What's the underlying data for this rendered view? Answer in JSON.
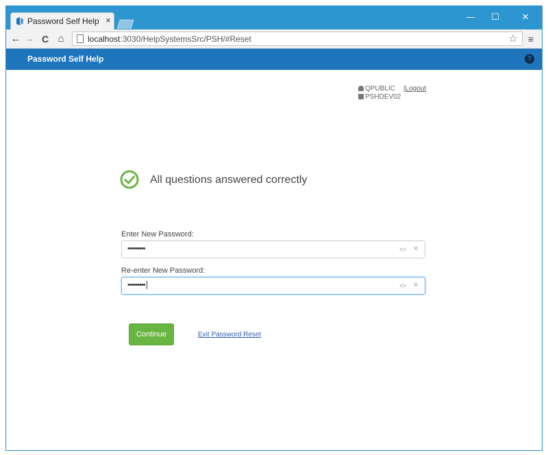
{
  "browser": {
    "tab_title": "Password Self Help V",
    "tab_close": "×",
    "url_host": "localhost",
    "url_path": ":3030/HelpSystemsSrc/PSH/#Reset",
    "window_minimize": "—",
    "window_maximize": "☐",
    "window_close": "✕",
    "back": "←",
    "forward": "→",
    "reload": "C",
    "home": "⌂",
    "bookmark_star": "☆",
    "menu": "≡"
  },
  "app": {
    "title": "Password Self Help",
    "help_icon": "?"
  },
  "user": {
    "username": "QPUBLIC",
    "separator": "|",
    "logout_label": "Logout",
    "system": "PSHDEV02"
  },
  "status": {
    "message": "All questions answered correctly"
  },
  "form": {
    "new_password_label": "Enter New Password:",
    "new_password_value": "•••••••••",
    "reenter_password_label": "Re-enter New Password:",
    "reenter_password_value": "•••••••••",
    "clear_glyph": "✕"
  },
  "actions": {
    "continue_label": "Continue",
    "exit_label": "Exit Password Reset"
  },
  "colors": {
    "titlebar": "#2d95cf",
    "appbar": "#1e75bc",
    "success_green": "#69b541",
    "link_blue": "#2a5db0"
  }
}
